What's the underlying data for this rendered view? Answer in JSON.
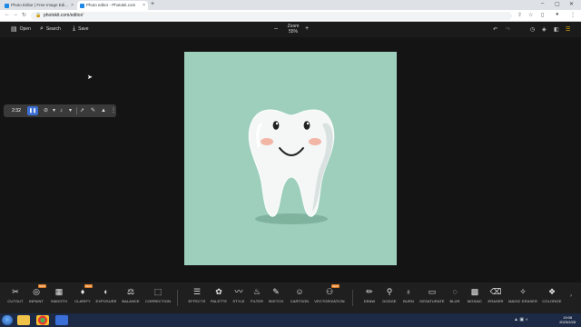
{
  "browser": {
    "tabs": [
      {
        "title": "Photo Editor | Free Image Edi...",
        "active": false
      },
      {
        "title": "Photo editor - Photokit.com",
        "active": true
      }
    ],
    "new_tab": "+",
    "url": "photokit.com/editor/"
  },
  "app": {
    "open_label": "Open",
    "search_label": "Search",
    "save_label": "Save",
    "zoom_label": "Zoom",
    "zoom_value": "55%"
  },
  "float_toolbar": {
    "timer": "2:32"
  },
  "tools": [
    {
      "label": "CUTOUT",
      "icon": "✂",
      "new": false
    },
    {
      "label": "INPAINT",
      "icon": "◎",
      "new": true
    },
    {
      "label": "SMOOTH",
      "icon": "▦",
      "new": false
    },
    {
      "label": "CLARIFY",
      "icon": "♦",
      "new": true
    },
    {
      "label": "EXPOSURE",
      "icon": "◐",
      "new": false
    },
    {
      "label": "BALANCE",
      "icon": "⚖",
      "new": false
    },
    {
      "label": "CORRECTION",
      "icon": "⬚",
      "new": false
    },
    {
      "label": "EFFECTS",
      "icon": "☰",
      "new": false
    },
    {
      "label": "PALETTE",
      "icon": "✿",
      "new": false
    },
    {
      "label": "STYLE",
      "icon": "〰",
      "new": false
    },
    {
      "label": "FILTER",
      "icon": "♨",
      "new": false
    },
    {
      "label": "SKETCH",
      "icon": "✎",
      "new": false
    },
    {
      "label": "CARTOON",
      "icon": "☺",
      "new": false
    },
    {
      "label": "VECTORIZATION",
      "icon": "⚇",
      "new": true
    },
    {
      "label": "DRAW",
      "icon": "✏",
      "new": false
    },
    {
      "label": "DODGE",
      "icon": "⚲",
      "new": false
    },
    {
      "label": "BURN",
      "icon": "♁",
      "new": false
    },
    {
      "label": "DESATURATE",
      "icon": "▭",
      "new": false
    },
    {
      "label": "BLUR",
      "icon": "◌",
      "new": false
    },
    {
      "label": "MOSAIC",
      "icon": "▩",
      "new": false
    },
    {
      "label": "ERASER",
      "icon": "⌫",
      "new": false
    },
    {
      "label": "MAGIC ERASER",
      "icon": "✧",
      "new": false
    },
    {
      "label": "COLORIZE",
      "icon": "❖",
      "new": false
    }
  ],
  "tools_new_badge": "NEW",
  "taskbar": {
    "time": "19:08",
    "date": "2023/2/28"
  }
}
